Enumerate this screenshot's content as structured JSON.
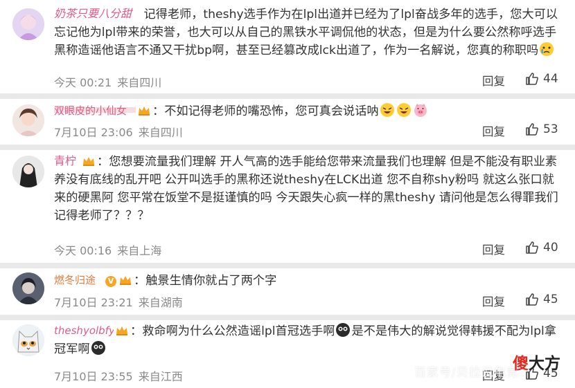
{
  "comments": [
    {
      "username": "奶茶只要八分甜",
      "text": "记得老师，theshy选手作为在lpl出道并已经为了lpl奋战多年的选手，您大可以忘记他为lpl带来的荣誉，也大可以从自己的黑铁水平调侃他的状态，但是为什么要公然称呼选手黑称造谣他语言不通又干扰bp啊，甚至已经篡改成lck出道了，作为一名解说，您真的称职吗",
      "time": "今天 00:21",
      "location": "来自四川",
      "reply_label": "回复",
      "likes": "44"
    },
    {
      "username": "双眼皮的小仙女",
      "text": "不如记得老师的嘴恐怖，您可真会说话呐",
      "time": "7月10日 23:06",
      "location": "来自四川",
      "reply_label": "回复",
      "likes": "53"
    },
    {
      "username": "青柠",
      "text": "您想要流量我们理解 开人气高的选手能给您带来流量我们也理解 但是不能没有职业素养没有底线的乱开吧 公开叫选手的黑称还说theshy在LCK出道 您不自称shy粉吗 就这么张口就来的硬黑阿 您平常在饭堂不是挺谨慎的吗 今天跟失心疯一样的黑theshy 请问他是怎么得罪我们记得老师了？？？",
      "time": "今天 00:16",
      "location": "来自上海",
      "reply_label": "回复",
      "likes": "40"
    },
    {
      "username": "燃冬归途",
      "text": "触景生情你就占了两个字",
      "time": "7月10日 23:21",
      "location": "来自湖南",
      "reply_label": "回复",
      "likes": "45"
    },
    {
      "username": "theshyolbfyy",
      "text_part1": "救命啊为什么公然造谣lpl首冠选手啊",
      "text_part2": "是不是伟大的解说觉得韩援不配为lpl拿冠军啊",
      "time": "7月10日 23:55",
      "location": "来自江西",
      "reply_label": "回复",
      "likes": "45"
    }
  ],
  "watermark": "百家号/贝拉说电竞",
  "brand": {
    "part1": "傻",
    "part2": "大方"
  },
  "colors": {
    "username": "#e05a8a",
    "accent": "#f6a623"
  }
}
